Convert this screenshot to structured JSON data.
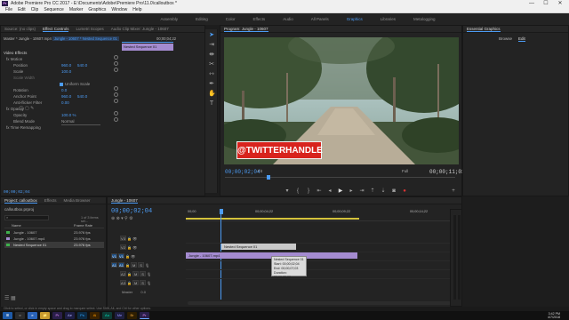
{
  "window": {
    "title": "Adobe Premiere Pro CC 2017 - E:\\Documents\\Adobe\\Premiere Pro\\11.0\\calloutbox *",
    "minimize": "—",
    "maximize": "☐",
    "close": "✕"
  },
  "menu": [
    "File",
    "Edit",
    "Clip",
    "Sequence",
    "Marker",
    "Graphics",
    "Window",
    "Help"
  ],
  "workspaces": {
    "items": [
      "Assembly",
      "Editing",
      "Color",
      "Effects",
      "Audio",
      "All Panels",
      "Graphics",
      "Libraries",
      "Metalogging"
    ],
    "active_index": 6
  },
  "source_panel": {
    "tabs": [
      "Source: (no clips)",
      "Effect Controls",
      "Lumetri Scopes",
      "Audio Clip Mixer: Jungle - 10607"
    ],
    "active_tab_index": 1,
    "master_label": "Master * Jungle - 10607.mp4",
    "sequence_label": "Jungle - 10607 * Nested Sequence 01",
    "timecode": "00;00;04;22",
    "clip_bar_label": "Nested Sequence 01",
    "section_video": "Video Effects",
    "effects": [
      {
        "name": "fx  Motion",
        "value": "",
        "value2": ""
      },
      {
        "name": "Position",
        "value": "960.0",
        "value2": "540.0"
      },
      {
        "name": "Scale",
        "value": "100.0",
        "value2": ""
      },
      {
        "name": "Scale Width",
        "value": "",
        "value2": ""
      },
      {
        "name": "",
        "value": "",
        "value2": "Uniform Scale"
      },
      {
        "name": "Rotation",
        "value": "0.0",
        "value2": ""
      },
      {
        "name": "Anchor Point",
        "value": "960.0",
        "value2": "540.0"
      },
      {
        "name": "Anti-flicker Filter",
        "value": "0.00",
        "value2": ""
      },
      {
        "name": "fx  Opacity",
        "value": "",
        "value2": ""
      },
      {
        "name": "Opacity",
        "value": "100.0 %",
        "value2": ""
      },
      {
        "name": "Blend Mode",
        "value": "Normal",
        "value2": ""
      },
      {
        "name": "fx  Time Remapping",
        "value": "",
        "value2": ""
      }
    ],
    "bottom_timecode": "00;00;02;04"
  },
  "program": {
    "title": "Program: Jungle - 10607",
    "handle_text": "@TWITTERHANDLE",
    "current_tc": "00;00;02;04",
    "fit": "Fit",
    "quality": "Full",
    "duration_tc": "00;00;11;03"
  },
  "essential": {
    "title": "Essential Graphics",
    "tabs": [
      "Browse",
      "Edit"
    ],
    "active_tab_index": 1
  },
  "project": {
    "tabs": [
      "Project: calloutbox",
      "Effects",
      "Media Browser"
    ],
    "file": "calloutbox.prproj",
    "count": "1 of 3 items sel...",
    "col_name": "Name",
    "col_rate": "Frame Rate",
    "items": [
      {
        "name": "Jungle - 10607",
        "rate": "23.976 fps",
        "color": "#3fb24d"
      },
      {
        "name": "Jungle - 10607.mp4",
        "rate": "23.976 fps",
        "color": "#a48bd0"
      },
      {
        "name": "Nested Sequence 01",
        "rate": "23.976 fps",
        "color": "#3fb24d"
      }
    ]
  },
  "timeline": {
    "tab": "Jungle - 10607",
    "timecode": "00;00;02;04",
    "ruler": [
      "00;00",
      "00;00;04;22",
      "00;00;09;22",
      "00;00;14;22"
    ],
    "tracks": [
      {
        "id": "V3",
        "target": "V3"
      },
      {
        "id": "V2",
        "target": "V2"
      },
      {
        "id": "V1",
        "target": "V1",
        "src": "V1"
      },
      {
        "id": "A1",
        "target": "A1",
        "src": "A1"
      },
      {
        "id": "A2",
        "target": "A2"
      },
      {
        "id": "A3",
        "target": "A3"
      }
    ],
    "master": "Master",
    "master_val": "0.0",
    "clip_nested": "Nested Sequence 01",
    "clip_video": "Jungle - 10607.mp4",
    "tooltip": [
      "Nested Sequence 01",
      "Start: 00;00;02;04",
      "End: 00;00;07;03",
      "Duration: 00;00;05;00"
    ]
  },
  "status": "Click to select, or click in empty space and drag to marquee select. Use Shift, Alt, and Ctrl for other options.",
  "taskbar": {
    "time": "3:42 PM",
    "date": "4/7/2018",
    "apps": [
      {
        "label": "⊞",
        "color": "#1e5aa8"
      },
      {
        "label": "○",
        "color": "#2a2a2a"
      },
      {
        "label": "e",
        "color": "#2a63b8"
      },
      {
        "label": "📁",
        "color": "#c89b2e"
      },
      {
        "label": "Pr",
        "color": "#2a1f4a"
      },
      {
        "label": "Ae",
        "color": "#1d1d44"
      },
      {
        "label": "Ps",
        "color": "#0c2a44"
      },
      {
        "label": "Ai",
        "color": "#3a2200"
      },
      {
        "label": "Au",
        "color": "#0e3b35"
      },
      {
        "label": "Me",
        "color": "#1e1e3e"
      },
      {
        "label": "Br",
        "color": "#2e1e00"
      },
      {
        "label": "Pr",
        "color": "#2a1f4a"
      }
    ]
  },
  "colors": {
    "accent": "#4c9cf5",
    "clip_purple": "#a48bd0",
    "clip_gray": "#c9c9c9",
    "green": "#3fb24d"
  }
}
